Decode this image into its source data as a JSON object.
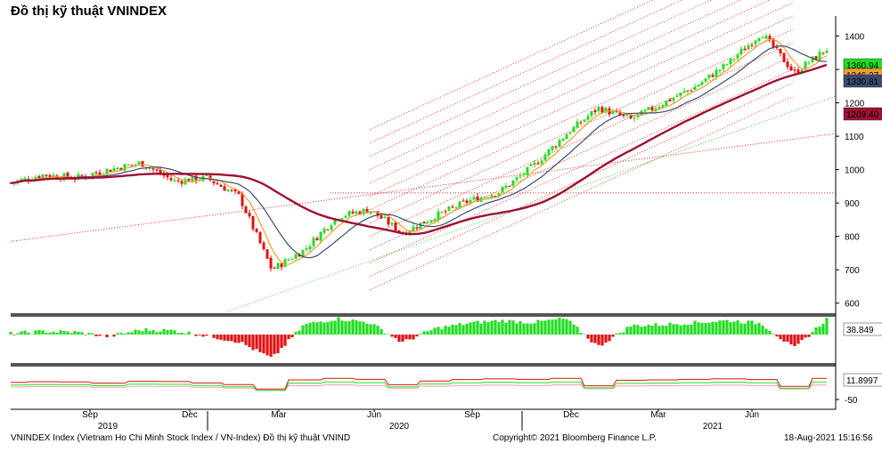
{
  "header": {
    "title": "Đồ thị kỹ thuật VNINDEX"
  },
  "footer": {
    "left": "VNINDEX Index (Vietnam Ho Chi Minh Stock Index / VN-Index) Đồ thị kỹ thuật VNIND",
    "center": "Copyright© 2021 Bloomberg Finance L.P.",
    "right": "18-Aug-2021 15:16:56"
  },
  "colors": {
    "up": "#22dd22",
    "down": "#e01010",
    "ma_short": "#f0a030",
    "ma_mid": "#3a4a70",
    "ma_long": "#a01030",
    "channel": "#ee2020",
    "trend": "#44cc44",
    "panel_bar": "#555555"
  },
  "chart_data": [
    {
      "type": "candlestick",
      "title": "",
      "ylim": [
        570,
        1460
      ],
      "yticks": [
        600,
        700,
        800,
        900,
        1000,
        1100,
        1200,
        1300,
        1400
      ],
      "x_month_labels": [
        "Sep",
        "Dec",
        "Mar",
        "Jun",
        "Sep",
        "Dec",
        "Mar",
        "Jun"
      ],
      "x_year_labels": [
        "2019",
        "2020",
        "2021"
      ],
      "price_path": [
        {
          "t": "2019-07",
          "v": 960
        },
        {
          "t": "2019-08",
          "v": 985
        },
        {
          "t": "2019-09",
          "v": 975
        },
        {
          "t": "2019-10",
          "v": 1000
        },
        {
          "t": "2019-11",
          "v": 1020
        },
        {
          "t": "2019-12",
          "v": 965
        },
        {
          "t": "2020-01",
          "v": 975
        },
        {
          "t": "2020-02",
          "v": 920
        },
        {
          "t": "2020-03",
          "v": 700
        },
        {
          "t": "2020-04",
          "v": 760
        },
        {
          "t": "2020-05",
          "v": 860
        },
        {
          "t": "2020-06",
          "v": 880
        },
        {
          "t": "2020-07",
          "v": 810
        },
        {
          "t": "2020-08",
          "v": 860
        },
        {
          "t": "2020-09",
          "v": 905
        },
        {
          "t": "2020-10",
          "v": 935
        },
        {
          "t": "2020-11",
          "v": 1010
        },
        {
          "t": "2020-12",
          "v": 1105
        },
        {
          "t": "2021-01",
          "v": 1185
        },
        {
          "t": "2021-02",
          "v": 1150
        },
        {
          "t": "2021-03",
          "v": 1200
        },
        {
          "t": "2021-04",
          "v": 1250
        },
        {
          "t": "2021-05",
          "v": 1320
        },
        {
          "t": "2021-06",
          "v": 1410
        },
        {
          "t": "2021-07",
          "v": 1290
        },
        {
          "t": "2021-08",
          "v": 1361
        }
      ],
      "value_labels": [
        {
          "label": "1360.94",
          "color": "#22dd22"
        },
        {
          "label": "1346.27",
          "color": "#f0a030"
        },
        {
          "label": "1330.81",
          "color": "#3a4a70"
        },
        {
          "label": "1209.40",
          "color": "#a01030"
        }
      ],
      "horizontal_level": 930
    },
    {
      "type": "bar",
      "title": "",
      "value_label": "38.849",
      "description_values": [
        2,
        8,
        6,
        -5,
        12,
        10,
        -3,
        -18,
        -60,
        25,
        40,
        30,
        -20,
        15,
        28,
        35,
        30,
        40,
        -30,
        22,
        25,
        30,
        35,
        28,
        -35,
        39
      ]
    },
    {
      "type": "line",
      "title": "",
      "value_label": "11.8997",
      "ytick": "-50"
    }
  ]
}
